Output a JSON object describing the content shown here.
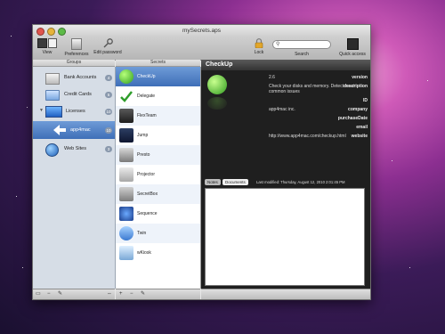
{
  "window": {
    "title": "mySecrets.aps"
  },
  "toolbar": {
    "view_label": "View",
    "preferences_label": "Preferences",
    "edit_password_label": "Edit password",
    "lock_label": "Lock",
    "search_label": "Search",
    "quick_access_label": "Quick access",
    "search_value": ""
  },
  "columns": {
    "groups": "Groups",
    "secrets": "Secrets"
  },
  "groups": [
    {
      "label": "Bank Accounts",
      "count": "4",
      "icon": "bank-icon"
    },
    {
      "label": "Credit Cards",
      "count": "5",
      "icon": "credit-card-icon"
    },
    {
      "label": "Licenses",
      "count": "10",
      "icon": "licenses-icon"
    },
    {
      "label": "app4mac",
      "count": "10",
      "icon": "arrow-icon"
    },
    {
      "label": "Web Sites",
      "count": "3",
      "icon": "globe-icon"
    }
  ],
  "secrets": [
    {
      "label": "CheckUp",
      "icon": "checkup-icon"
    },
    {
      "label": "Delegate",
      "icon": "delegate-icon"
    },
    {
      "label": "FlexTeam",
      "icon": "flexteam-icon"
    },
    {
      "label": "Jump",
      "icon": "jump-icon"
    },
    {
      "label": "Presto",
      "icon": "presto-icon"
    },
    {
      "label": "Projector",
      "icon": "projector-icon"
    },
    {
      "label": "SecretBox",
      "icon": "secretbox-icon"
    },
    {
      "label": "Sequence",
      "icon": "sequence-icon"
    },
    {
      "label": "Twin",
      "icon": "twin-icon"
    },
    {
      "label": "wKiosk",
      "icon": "wkiosk-icon"
    }
  ],
  "detail": {
    "title": "CheckUp",
    "fields": [
      {
        "key": "version",
        "value": "2.6"
      },
      {
        "key": "description",
        "value": "Check your disks and memory. Detect most common issues"
      },
      {
        "key": "ID",
        "value": ""
      },
      {
        "key": "company",
        "value": "app4mac inc."
      },
      {
        "key": "purchaseDate",
        "value": ""
      },
      {
        "key": "email",
        "value": ""
      },
      {
        "key": "website",
        "value": "http://www.app4mac.com/checkup.html"
      }
    ],
    "tabs": [
      "Notes",
      "Documents"
    ],
    "last_modified": "Last modified: Thursday, August 12, 2010 2:01:45 PM"
  },
  "colors": {
    "selection": "#3f6fb8",
    "accent": "#6e9bd7"
  }
}
